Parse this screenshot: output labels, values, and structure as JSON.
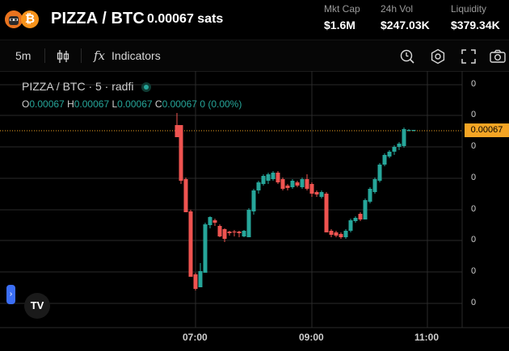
{
  "header": {
    "pair": "PIZZA / BTC",
    "price": "0.00067 sats",
    "stats": [
      {
        "label": "Mkt Cap",
        "value": "$1.6M"
      },
      {
        "label": "24h Vol",
        "value": "$247.03K"
      },
      {
        "label": "Liquidity",
        "value": "$379.34K"
      }
    ],
    "btc_symbol": "₿"
  },
  "toolbar": {
    "interval": "5m",
    "indicators_label": "Indicators",
    "fx_symbol": "𝑓x"
  },
  "legend": {
    "symbol": "PIZZA / BTC · 5 · radfi",
    "o_label": "O",
    "o_value": "0.00067",
    "h_label": "H",
    "h_value": "0.00067",
    "l_label": "L",
    "l_value": "0.00067",
    "c_label": "C",
    "c_value": "0.00067",
    "change": "0 (0.00%)"
  },
  "axis": {
    "y_labels": [
      "0",
      "0",
      "0",
      "0",
      "0",
      "0",
      "0",
      "0"
    ],
    "current_price_tag": "0.00067",
    "time_labels": [
      "07:00",
      "09:00",
      "11:00"
    ]
  },
  "colors": {
    "up": "#26a69a",
    "down": "#ef5350",
    "price_line": "#f5a524",
    "grid": "#2a2a2a"
  },
  "tv_logo_text": "TV",
  "side_handle_text": "›"
}
